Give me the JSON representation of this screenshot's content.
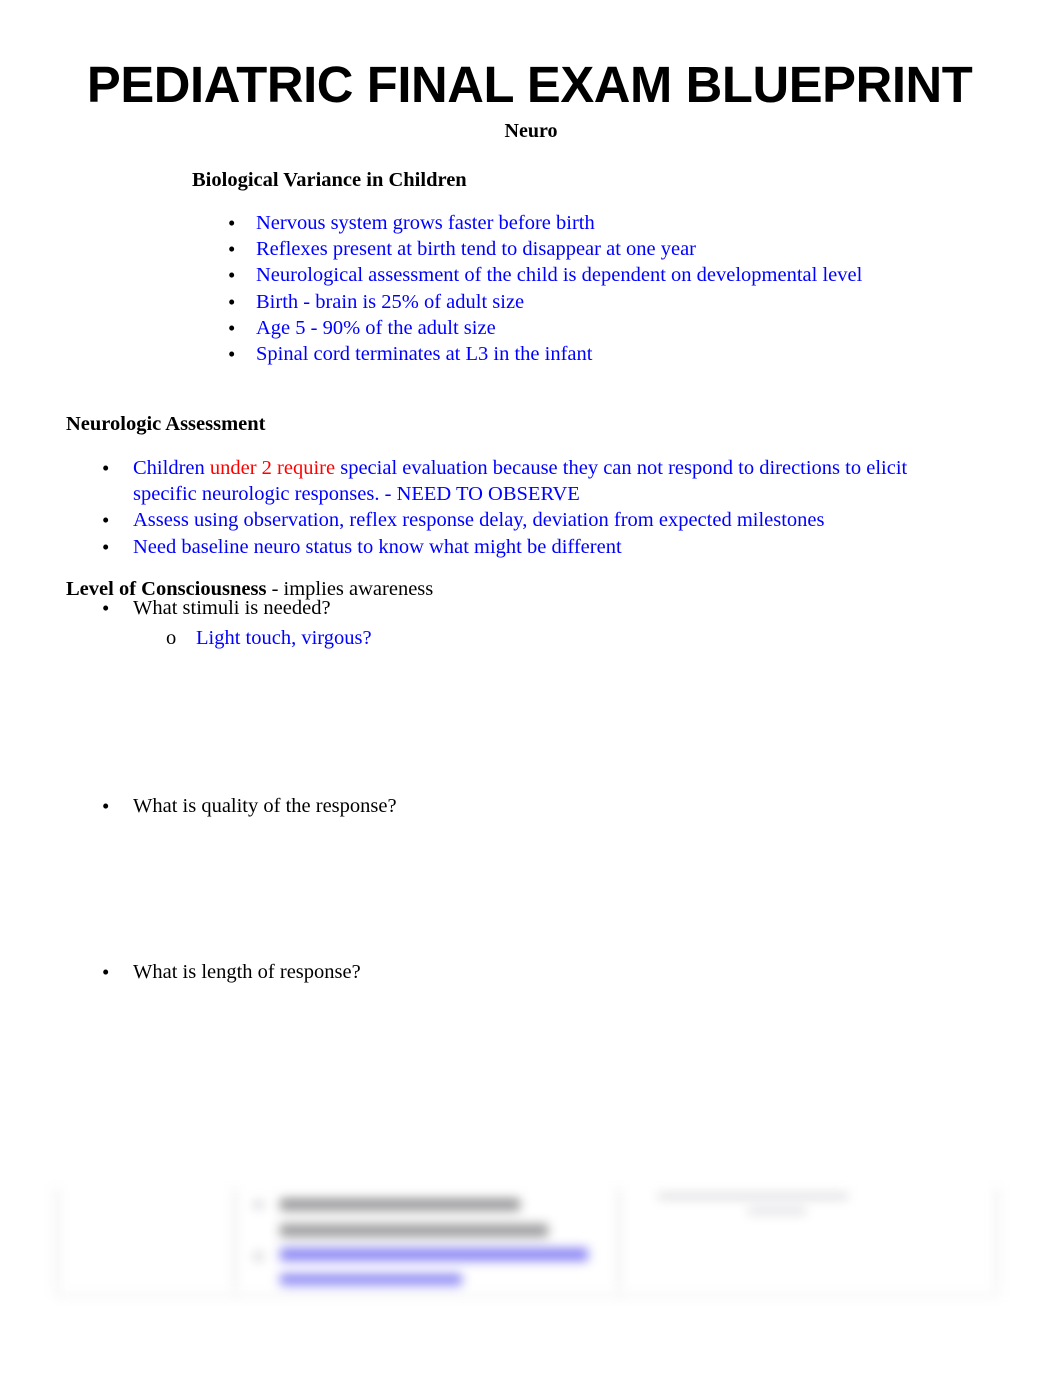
{
  "document": {
    "title": "PEDIATRIC FINAL EXAM BLUEPRINT",
    "subtitle": "Neuro"
  },
  "colors": {
    "body_text": "#000000",
    "blue_text": "#0000ff",
    "red_text": "#ff0000",
    "preview_link": "#5b54f0"
  },
  "sections": {
    "biological_variance": {
      "heading": "Biological Variance in Children",
      "bullets": [
        "Nervous system grows faster before birth",
        "Reflexes present at birth tend to disappear at one year",
        "Neurological assessment of the child is dependent on developmental level",
        "Birth - brain is 25% of adult size",
        "Age 5 - 90% of the adult size",
        "Spinal cord terminates at L3 in the infant"
      ]
    },
    "neurologic_assessment": {
      "heading": "Neurologic Assessment",
      "bullet_1": {
        "part_a": "Children ",
        "part_b_red": "under 2 require",
        "part_c": " special evaluation because they can not respond to directions to elicit specific neurologic responses. - NEED TO OBSERVE"
      },
      "bullet_2": "Assess using observation, reflex response delay, deviation from expected milestones",
      "bullet_3": "Need baseline neuro status to know what might be different"
    },
    "level_of_consciousness": {
      "heading_bold": "Level of Consciousness",
      "heading_rest": " - implies awareness",
      "bullet_stimuli": "What stimuli is needed?",
      "sub_bullet_stimuli": "Light touch, virgous?",
      "bullet_quality": "What is quality of the response?",
      "bullet_length": "What is length of response?"
    }
  },
  "markers": {
    "disc": "•",
    "circle": "o"
  },
  "preview": {
    "note": "blurred next-page table preview"
  }
}
